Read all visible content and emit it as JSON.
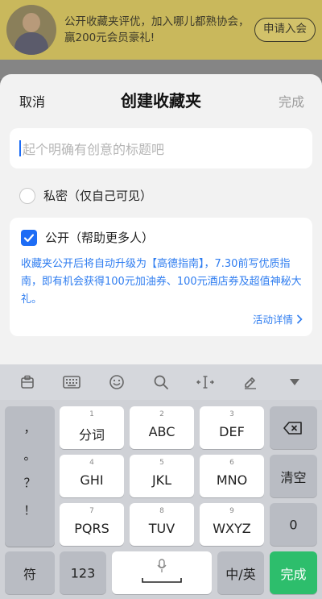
{
  "banner": {
    "text": "公开收藏夹评优，加入哪儿都熟协会，赢200元会员豪礼!",
    "join_label": "申请入会"
  },
  "sheet": {
    "cancel_label": "取消",
    "title": "创建收藏夹",
    "done_label": "完成",
    "title_placeholder": "起个明确有创意的标题吧",
    "private_label": "私密（仅自己可见）",
    "public_label": "公开（帮助更多人）",
    "public_checked": true,
    "public_desc": "收藏夹公开后将自动升级为【高德指南】，7.30前写优质指南，即有机会获得100元加油券、100元酒店券及超值神秘大礼。",
    "detail_link": "活动详情"
  },
  "keyboard": {
    "toolbar_icons": [
      "clipboard-icon",
      "keyboard-icon",
      "emoji-icon",
      "search-icon",
      "cursor-move-icon",
      "edit-icon",
      "collapse-icon"
    ],
    "punctuation": [
      "，",
      "。",
      "？",
      "！"
    ],
    "rows": [
      [
        {
          "sub": "1",
          "main": "分词"
        },
        {
          "sub": "2",
          "main": "ABC"
        },
        {
          "sub": "3",
          "main": "DEF"
        }
      ],
      [
        {
          "sub": "4",
          "main": "GHI"
        },
        {
          "sub": "5",
          "main": "JKL"
        },
        {
          "sub": "6",
          "main": "MNO"
        }
      ],
      [
        {
          "sub": "7",
          "main": "PQRS"
        },
        {
          "sub": "8",
          "main": "TUV"
        },
        {
          "sub": "9",
          "main": "WXYZ"
        }
      ]
    ],
    "backspace_icon": "backspace-icon",
    "clear_label": "清空",
    "zero_label": "0",
    "symbol_label": "符",
    "num_label": "123",
    "lang_label": "中/英",
    "done_label": "完成",
    "accent": "#2dbe6c"
  }
}
